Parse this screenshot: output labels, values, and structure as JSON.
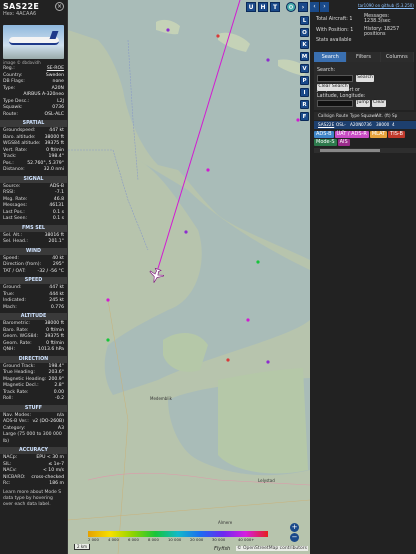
{
  "aircraft": {
    "callsign": "SAS22E",
    "hex_label": "Hex:",
    "hex": "4ACAA6",
    "photo_credit": "image © dbdavidh"
  },
  "info_rows": [
    {
      "k": "Reg.:",
      "v": "SE-ROE",
      "link": true
    },
    {
      "k": "Country:",
      "v": "Sweden"
    },
    {
      "k": "DB Flags:",
      "v": "none"
    },
    {
      "k": "Type:",
      "v": "A20N"
    },
    {
      "k": "",
      "v": "AIRBUS A-320neo"
    },
    {
      "k": "Type Desc.:",
      "v": "L2J"
    },
    {
      "k": "Squawk:",
      "v": "0736"
    },
    {
      "k": "Route:",
      "v": "OSL-ALC"
    }
  ],
  "sections": [
    {
      "title": "SPATIAL",
      "rows": [
        [
          "Groundspeed:",
          "447 kt"
        ],
        [
          "Baro. altitude:",
          "38000 ft"
        ],
        [
          "WGS84 altitude:",
          "39375 ft"
        ],
        [
          "Vert. Rate:",
          "0 ft/min"
        ],
        [
          "Track:",
          "198.4°"
        ],
        [
          "Pos.:",
          "52.760°, 5.379°"
        ],
        [
          "Distance:",
          "32.0 nmi"
        ]
      ]
    },
    {
      "title": "SIGNAL",
      "rows": [
        [
          "Source:",
          "ADS-B"
        ],
        [
          "RSSI:",
          "-7.1"
        ],
        [
          "Msg. Rate:",
          "46.8"
        ],
        [
          "Messages:",
          "46131"
        ],
        [
          "Last Pos.:",
          "0.1 s"
        ],
        [
          "Last Seen:",
          "0.1 s"
        ]
      ]
    },
    {
      "title": "FMS SEL",
      "rows": [
        [
          "Sel. Alt.:",
          "38016 ft"
        ],
        [
          "Sel. Head.:",
          "201.1°"
        ]
      ]
    },
    {
      "title": "WIND",
      "rows": [
        [
          "Speed:",
          "40 kt"
        ],
        [
          "Direction (from):",
          "295°"
        ],
        [
          "TAT / OAT:",
          "-32 / -56 °C"
        ]
      ]
    },
    {
      "title": "SPEED",
      "rows": [
        [
          "Ground:",
          "447 kt"
        ],
        [
          "True:",
          "444 kt"
        ],
        [
          "Indicated:",
          "245 kt"
        ],
        [
          "Mach:",
          "0.776"
        ]
      ]
    },
    {
      "title": "ALTITUDE",
      "rows": [
        [
          "Barometric:",
          "38000 ft"
        ],
        [
          "Baro. Rate:",
          "0 ft/min"
        ],
        [
          "Geom. WGS84:",
          "39375 ft"
        ],
        [
          "Geom. Rate:",
          "0 ft/min"
        ],
        [
          "QNH:",
          "1013.6 hPa"
        ]
      ]
    },
    {
      "title": "DIRECTION",
      "rows": [
        [
          "Ground Track:",
          "198.4°"
        ],
        [
          "True Heading:",
          "203.6°"
        ],
        [
          "Magnetic Heading:",
          "200.9°"
        ],
        [
          "Magnetic Decl.:",
          "2.8°"
        ],
        [
          "Track Rate:",
          "0.00"
        ],
        [
          "Roll:",
          "-0.2"
        ]
      ]
    },
    {
      "title": "STUFF",
      "rows": [
        [
          "Nav. Modes:",
          "n/a"
        ],
        [
          "ADS-B Ver.:",
          "v2 (DO-260B)"
        ],
        [
          "Category:",
          "A3"
        ],
        [
          "Large (75 000 to 300 000 lb)",
          ""
        ]
      ]
    },
    {
      "title": "ACCURACY",
      "rows": [
        [
          "NACp:",
          "EPU < 30 m"
        ],
        [
          "SIL:",
          "≤ 1e-7"
        ],
        [
          "NACv:",
          "< 10 m/s"
        ],
        [
          "NICBARO:",
          "cross-checked"
        ],
        [
          "Rc:",
          "186 m"
        ]
      ]
    }
  ],
  "note": "Learn more about Mode S data type by hovering over each data label.",
  "map": {
    "top_buttons": [
      "U",
      "H",
      "T"
    ],
    "side_buttons": [
      "L",
      "O",
      "K",
      "M",
      "V",
      "P",
      "I",
      "R",
      "F"
    ],
    "zoom_in": "+",
    "zoom_out": "−",
    "scale": "2 km",
    "attribution": "© OpenStreetMap contributors",
    "brand": "Flyfish",
    "altitude_legend": [
      "2 000",
      "4 000",
      "6 000",
      "8 000",
      "10 000",
      "20 000",
      "30 000",
      "40 000+"
    ],
    "places": [
      "Medemblik",
      "Lelystad",
      "Almere"
    ]
  },
  "right": {
    "github_link": "tar1090 on github (5.3.250)",
    "total_aircraft": "Total Aircraft: 1",
    "messages": "Messages: 1238.3/sec",
    "with_positions": "With Position: 1",
    "history": "History: 18257 positions",
    "stats_available": "Stats available",
    "tabs": [
      "Search",
      "Filters",
      "Columns"
    ],
    "search_label": "Search:",
    "search_btn": "Search",
    "clear_search": "Clear Search",
    "jump_label": "Jump to Airport or Latitude, Longitude:",
    "jump_btn": "Jump",
    "clear_btn": "Clear",
    "table_headers": [
      "Callsign",
      "Route",
      "Type",
      "Squawk",
      "Alt. (ft)",
      "Sp"
    ],
    "table_row": [
      "SAS22E",
      "OSL-ALC",
      "A20N",
      "0736",
      "38000",
      "4"
    ],
    "badges": [
      {
        "text": "ADS-B",
        "bg": "#3f86c7"
      },
      {
        "text": "UAT / ADS-R",
        "bg": "#c94cc4"
      },
      {
        "text": "MLAT",
        "bg": "#e6a23c"
      },
      {
        "text": "TIS-B",
        "bg": "#c0392b"
      },
      {
        "text": "Mode-S",
        "bg": "#2c7a4c"
      },
      {
        "text": "AIS",
        "bg": "#9b2c8c"
      }
    ]
  }
}
